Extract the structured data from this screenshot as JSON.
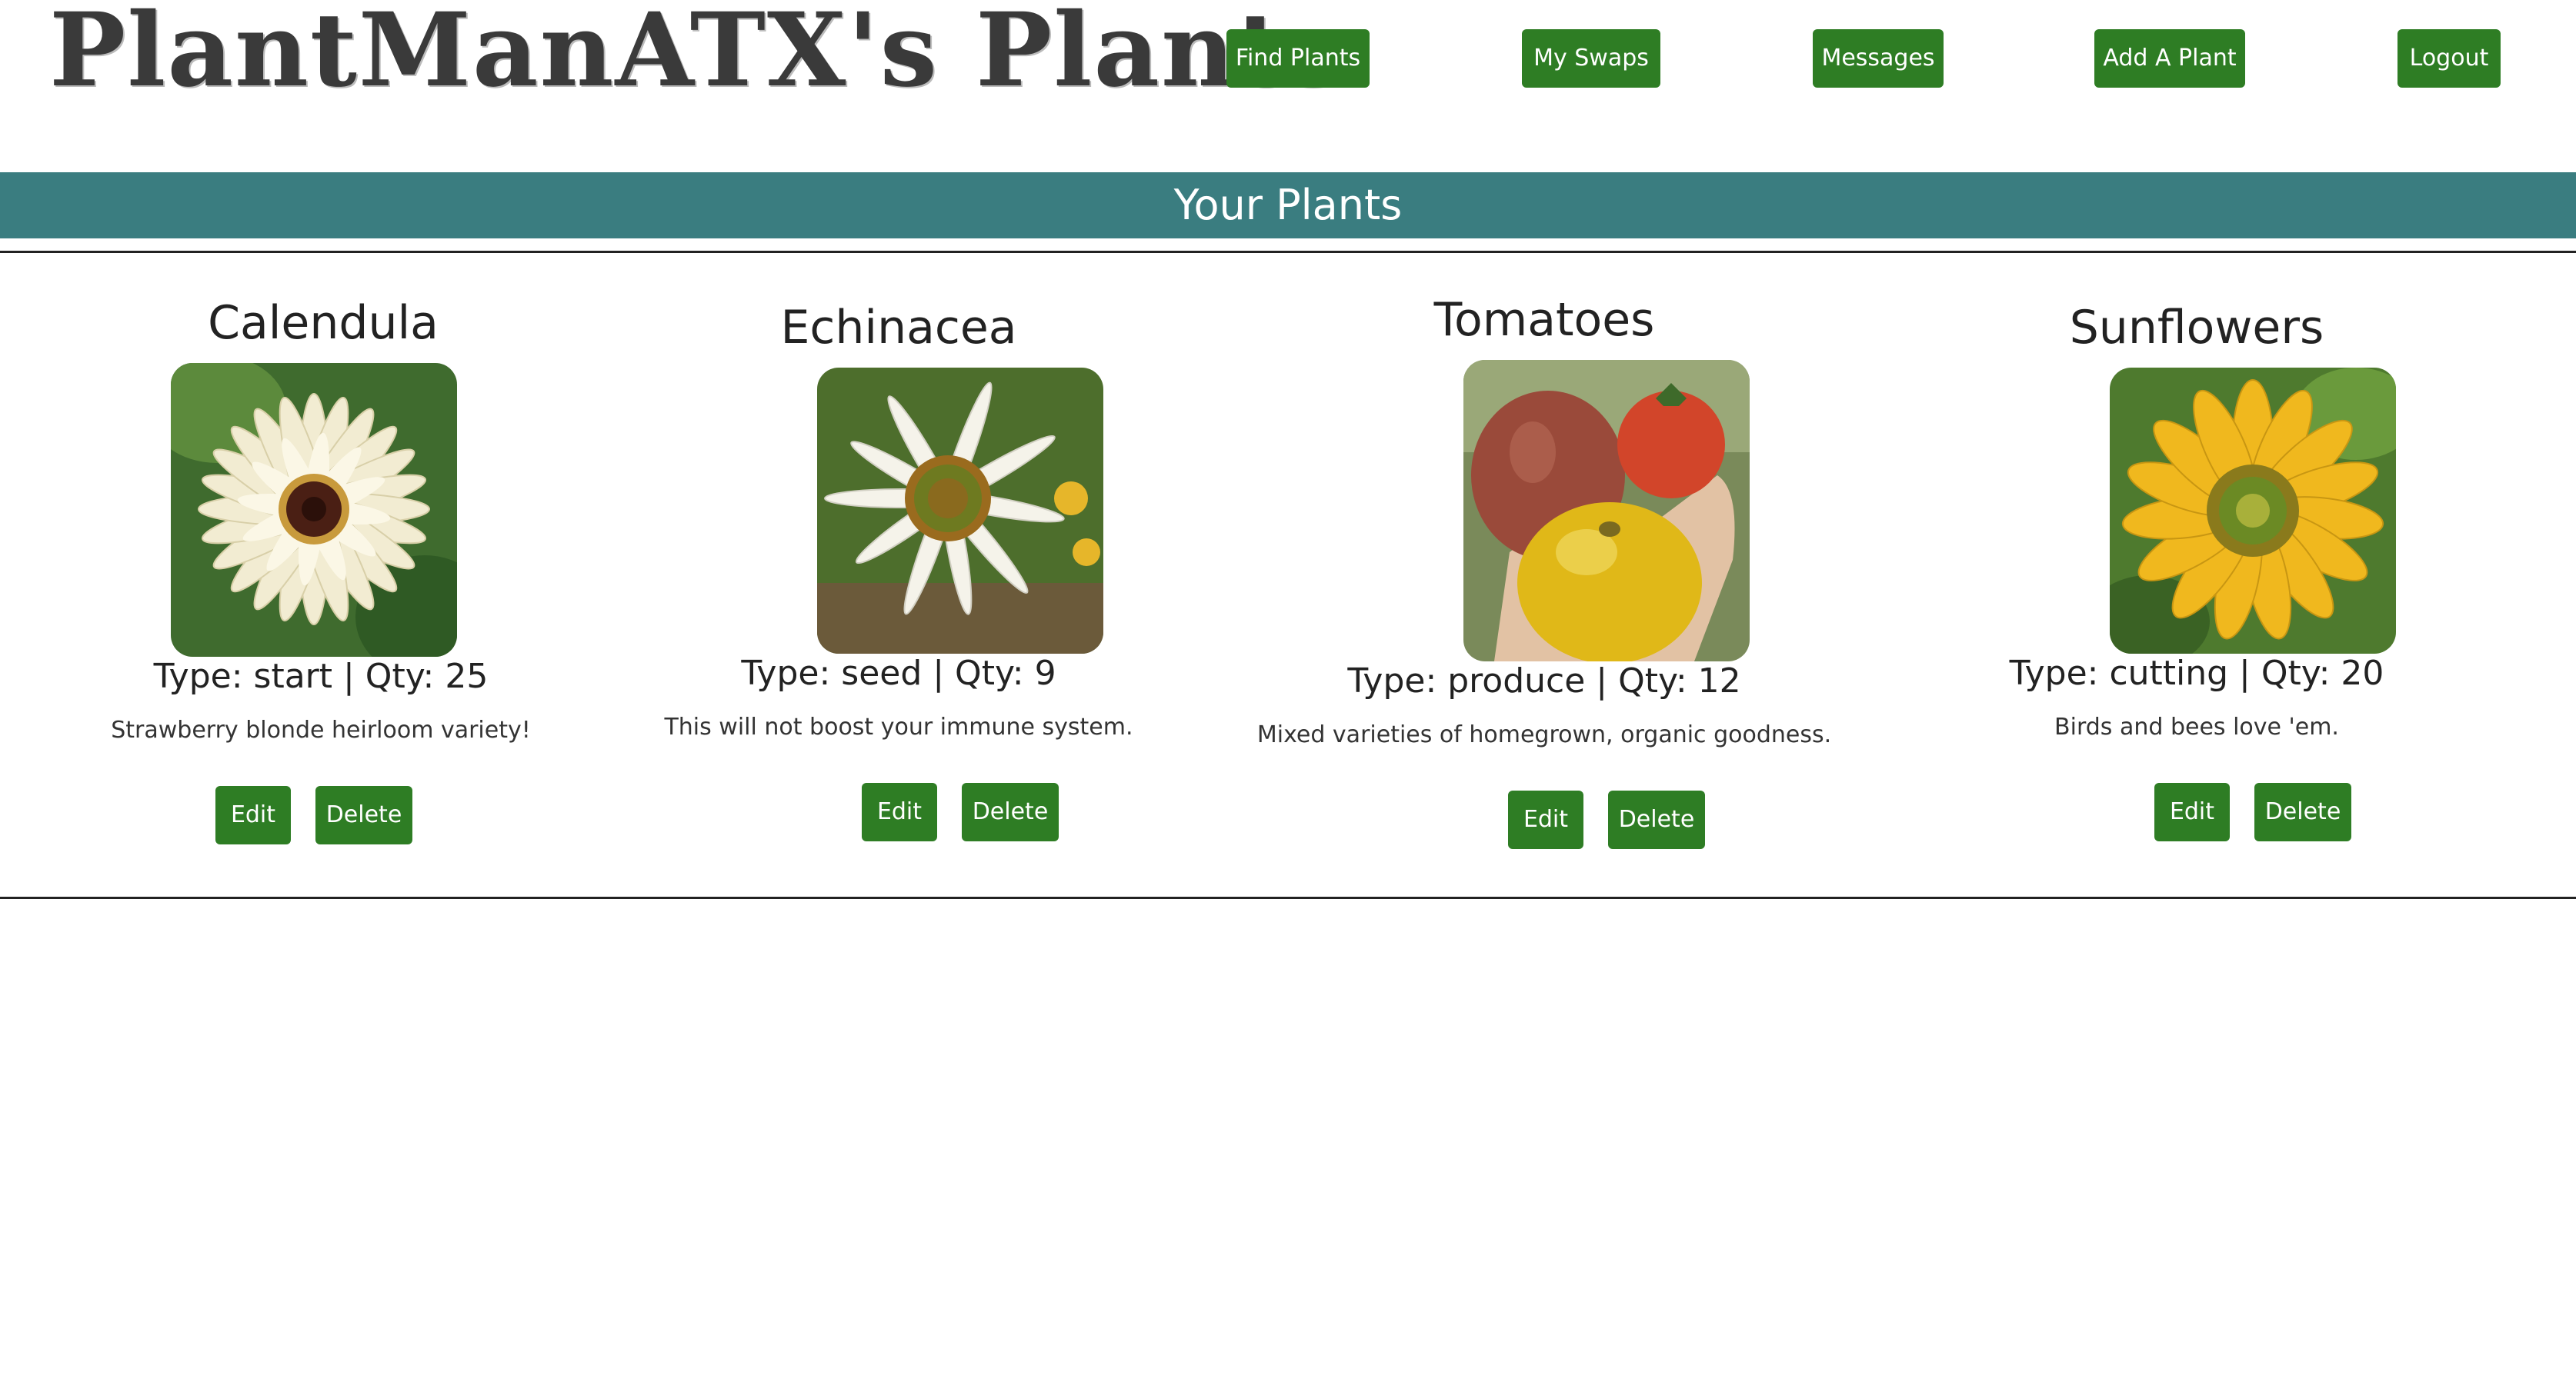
{
  "header": {
    "site_title": "PlantManATX's Plants",
    "nav": [
      {
        "label": "Find Plants"
      },
      {
        "label": "My Swaps"
      },
      {
        "label": "Messages"
      },
      {
        "label": "Add A Plant"
      },
      {
        "label": "Logout"
      }
    ]
  },
  "banner": {
    "title": "Your Plants"
  },
  "colors": {
    "button_green": "#2e7d24",
    "banner_teal": "#3a7d80"
  },
  "plants": [
    {
      "name": "Calendula",
      "type_qty": "Type: start | Qty: 25",
      "description": "Strawberry blonde heirloom variety!",
      "photo_icon": "calendula-photo",
      "edit_label": "Edit",
      "delete_label": "Delete"
    },
    {
      "name": "Echinacea",
      "type_qty": "Type: seed | Qty: 9",
      "description": "This will not boost your immune system.",
      "photo_icon": "echinacea-photo",
      "edit_label": "Edit",
      "delete_label": "Delete"
    },
    {
      "name": "Tomatoes",
      "type_qty": "Type: produce | Qty: 12",
      "description": "Mixed varieties of homegrown, organic goodness.",
      "photo_icon": "tomatoes-photo",
      "edit_label": "Edit",
      "delete_label": "Delete"
    },
    {
      "name": "Sunflowers",
      "type_qty": "Type: cutting | Qty: 20",
      "description": "Birds and bees love 'em.",
      "photo_icon": "sunflowers-photo",
      "edit_label": "Edit",
      "delete_label": "Delete"
    }
  ]
}
